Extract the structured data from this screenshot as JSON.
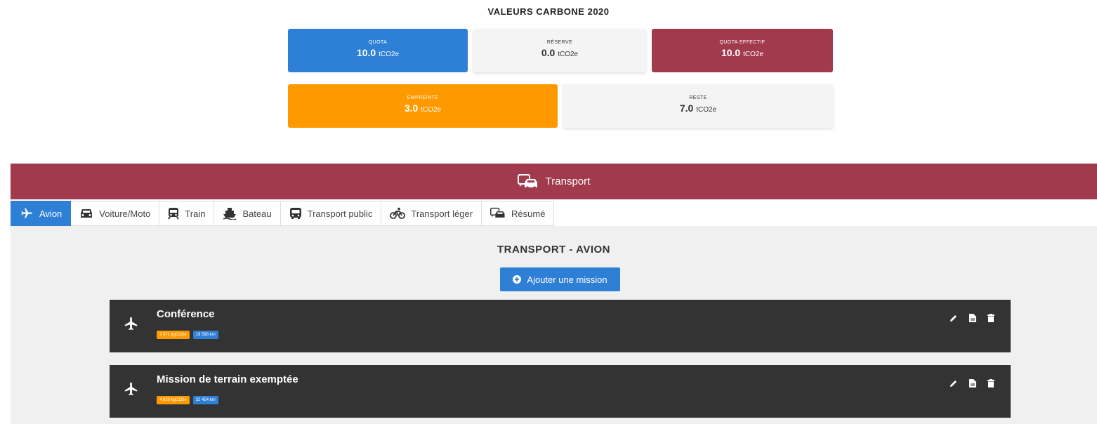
{
  "summary": {
    "title": "VALEURS CARBONE 2020",
    "unit": "tCO2e",
    "cards": {
      "quota": {
        "label": "QUOTA",
        "value": "10.0"
      },
      "reserve": {
        "label": "RÉSERVE",
        "value": "0.0"
      },
      "quota_effectif": {
        "label": "QUOTA EFFECTIF",
        "value": "10.0"
      },
      "empreinte": {
        "label": "EMPREINTE",
        "value": "3.0"
      },
      "reste": {
        "label": "RESTE",
        "value": "7.0"
      }
    }
  },
  "transport": {
    "title": "Transport",
    "icon": "transport-icon"
  },
  "tabs": [
    {
      "label": "Avion",
      "icon": "plane-icon",
      "active": true
    },
    {
      "label": "Voiture/Moto",
      "icon": "car-icon"
    },
    {
      "label": "Train",
      "icon": "train-icon"
    },
    {
      "label": "Bateau",
      "icon": "ship-icon"
    },
    {
      "label": "Transport public",
      "icon": "bus-icon"
    },
    {
      "label": "Transport léger",
      "icon": "bicycle-icon"
    },
    {
      "label": "Résumé",
      "icon": "transport-icon"
    }
  ],
  "section": {
    "title": "TRANSPORT - AVION",
    "add_button": "Ajouter une mission"
  },
  "missions": [
    {
      "title": "Conférence",
      "co2": "2 971 kgCO2e",
      "distance": "19 598 km"
    },
    {
      "title": "Mission de terrain exemptée",
      "co2": "4 920 kgCO2e",
      "distance": "32 454 km"
    }
  ],
  "colors": {
    "blue": "#2e7fd6",
    "red": "#a23a4e",
    "orange": "#ff9900",
    "dark": "#333333"
  }
}
